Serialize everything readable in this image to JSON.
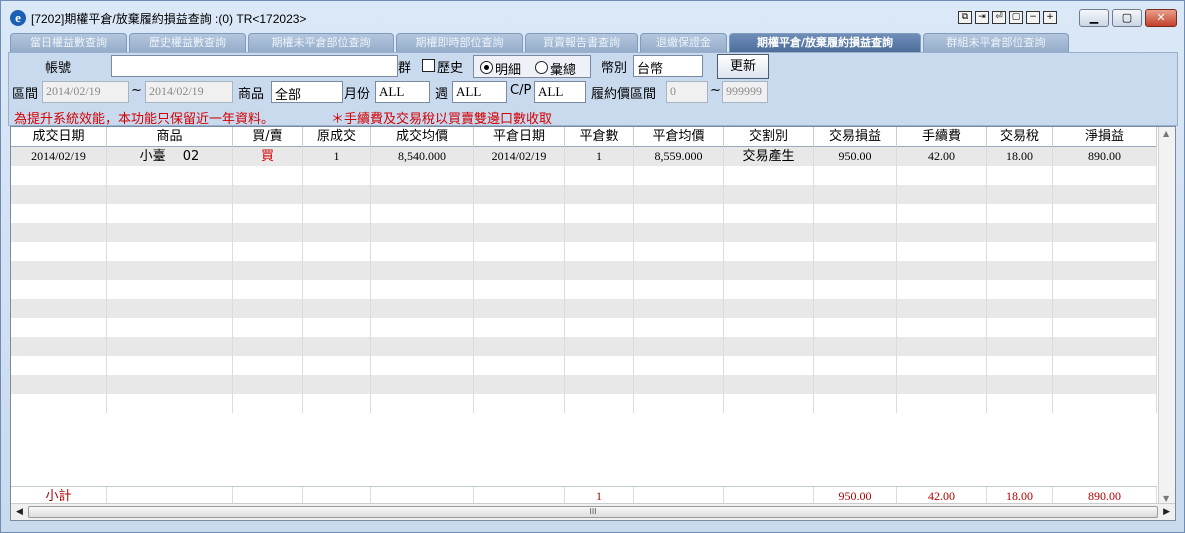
{
  "window": {
    "title": "[7202]期權平倉/放棄履約損益查詢 :(0) TR<172023>",
    "app_icon": "e",
    "mini_buttons": [
      "⧉",
      "⇥",
      "⏎",
      "▢",
      "−",
      "+"
    ]
  },
  "tabs": [
    {
      "label": "當日權益數查詢"
    },
    {
      "label": "歷史權益數查詢"
    },
    {
      "label": "期權未平倉部位查詢"
    },
    {
      "label": "期權即時部位查詢"
    },
    {
      "label": "買賣報告書查詢"
    },
    {
      "label": "退繳保證金"
    },
    {
      "label": "期權平倉/放棄履約損益查詢",
      "active": true
    },
    {
      "label": "群組未平倉部位查詢"
    }
  ],
  "form": {
    "account_label": "帳號",
    "account_value": "",
    "group_label": "群",
    "history_label": "歷史",
    "detail_label": "明細",
    "summary_label": "彙總",
    "currency_label": "幣別",
    "currency_value": "台幣",
    "refresh_label": "更新",
    "period_label": "區間",
    "date_from": "2014/02/19",
    "date_sep": "~",
    "date_to": "2014/02/19",
    "product_label": "商品",
    "product_value": "全部",
    "month_label": "月份",
    "month_value": "ALL",
    "week_label": "週",
    "week_value": "ALL",
    "cp_label": "C/P",
    "cp_value": "ALL",
    "strike_label": "履約價區間",
    "strike_from": "0",
    "strike_sep": "~",
    "strike_to": "999999"
  },
  "notice": {
    "text1": "為提升系統效能，本功能只保留近一年資料。",
    "text2": "＊手續費及交易稅以買賣雙邊口數收取"
  },
  "table": {
    "columns": [
      "成交日期",
      "商品",
      "買/賣",
      "原成交",
      "成交均價",
      "平倉日期",
      "平倉數",
      "平倉均價",
      "交割別",
      "交易損益",
      "手續費",
      "交易稅",
      "淨損益"
    ],
    "rows": [
      [
        "2014/02/19",
        "小臺　 02",
        "買",
        "1",
        "8,540.000",
        "2014/02/19",
        "1",
        "8,559.000",
        "交易產生",
        "950.00",
        "42.00",
        "18.00",
        "890.00"
      ]
    ],
    "subtotal": [
      "小計",
      "",
      "",
      "",
      "",
      "",
      "1",
      "",
      "",
      "950.00",
      "42.00",
      "18.00",
      "890.00"
    ]
  },
  "hscroll_grip": "III"
}
